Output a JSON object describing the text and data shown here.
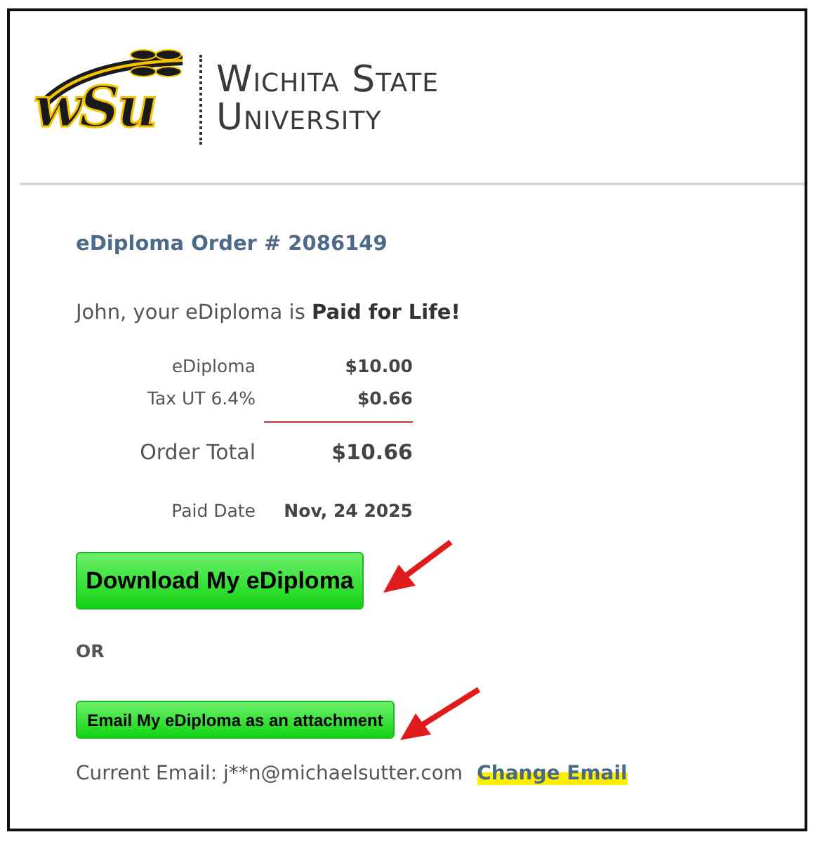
{
  "header": {
    "logo_mark": "wSu",
    "name_line1": "Wichita State",
    "name_line2": "University"
  },
  "order": {
    "title": "eDiploma Order # 2086149",
    "greeting": "John, your eDiploma is **Paid for Life!**",
    "line_items": [
      {
        "label": "eDiploma",
        "amount": "$10.00"
      },
      {
        "label": "Tax UT 6.4%",
        "amount": "$0.66"
      }
    ],
    "total": {
      "label": "Order Total",
      "amount": "$10.66"
    },
    "paid": {
      "label": "Paid Date",
      "value": "Nov, 24 2025"
    }
  },
  "download_button": "Download My eDiploma",
  "or_text": "OR",
  "email_button": "Email My eDiploma as an attachment",
  "email": {
    "label": "Current Email: j**n@michaelsutter.com",
    "change_link": "Change Email",
    "highlighted": true
  }
}
